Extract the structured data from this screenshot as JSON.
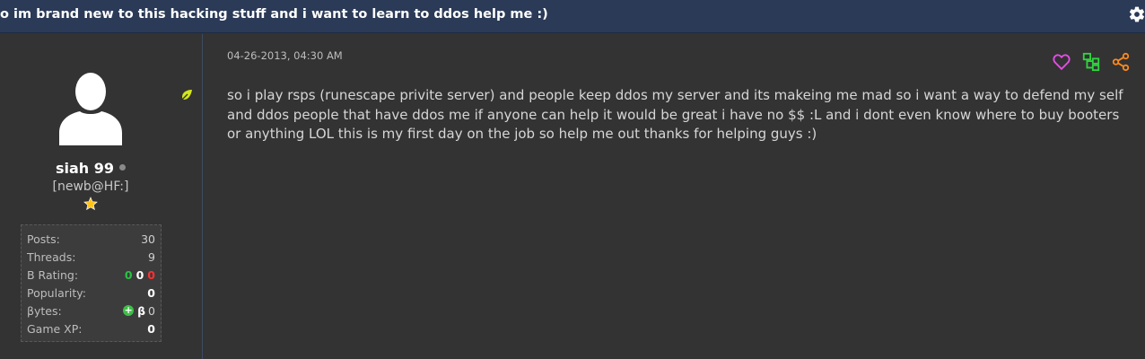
{
  "thread": {
    "title": "o im brand new to this hacking stuff and i want to learn to ddos help me :)"
  },
  "author": {
    "username": "siah 99",
    "usertitle": "[newb@HF:]",
    "stats": {
      "posts_label": "Posts:",
      "posts": "30",
      "threads_label": "Threads:",
      "threads": "9",
      "brating_label": "B Rating:",
      "brating_pos": "0",
      "brating_neutral": "0",
      "brating_neg": "0",
      "popularity_label": "Popularity:",
      "popularity": "0",
      "bytes_label": "βytes:",
      "bytes_symbol": "β",
      "bytes": "0",
      "gamexp_label": "Game XP:",
      "gamexp": "0"
    }
  },
  "post": {
    "date": "04-26-2013, 04:30 AM",
    "body": "so i play rsps (runescape privite server) and people keep ddos my server and its makeing me mad so i want a way to defend my self and ddos people that have ddos me if anyone can help it would be great i have no $$ :L and i dont even know where to buy booters or anything LOL this is my first day on the job so help me out thanks for helping guys :)"
  },
  "colors": {
    "header_bg": "#2b3a57",
    "page_bg": "#333333",
    "like": "#e84de8",
    "tree": "#2fd63e",
    "share": "#ff8a1c",
    "star": "#ffc21a",
    "leaf": "#d4e61a"
  },
  "icons": [
    "gear-icon",
    "leaf-icon",
    "avatar-placeholder-icon",
    "star-icon",
    "heart-icon",
    "tree-icon",
    "share-icon",
    "plus-icon"
  ]
}
